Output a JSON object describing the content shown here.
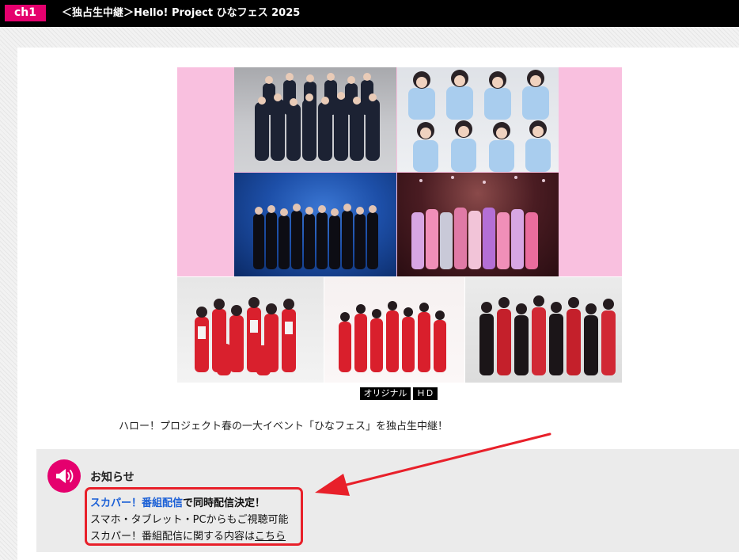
{
  "header": {
    "channel": "ch1",
    "title": "＜独占生中継＞Hello! Project ひなフェス 2025"
  },
  "program": {
    "tags": [
      "オリジナル",
      "ＨＤ"
    ],
    "description": "ハロー！プロジェクト春の一大イベント「ひなフェス」を独占生中継！"
  },
  "notice": {
    "heading": "お知らせ",
    "line1_link": "スカパー！番組配信",
    "line1_rest": "で同時配信決定！",
    "line2": "スマホ・タブレット・PCからもご視聴可能",
    "line3_text": "スカパー！番組配信に関する内容は",
    "line3_link": "こちら"
  },
  "icons": [
    "megaphone-icon"
  ],
  "colors": {
    "accent": "#e5006e",
    "link": "#1a5fd6",
    "annotation": "#e8202a",
    "key_visual_background": "#f9c0df"
  }
}
